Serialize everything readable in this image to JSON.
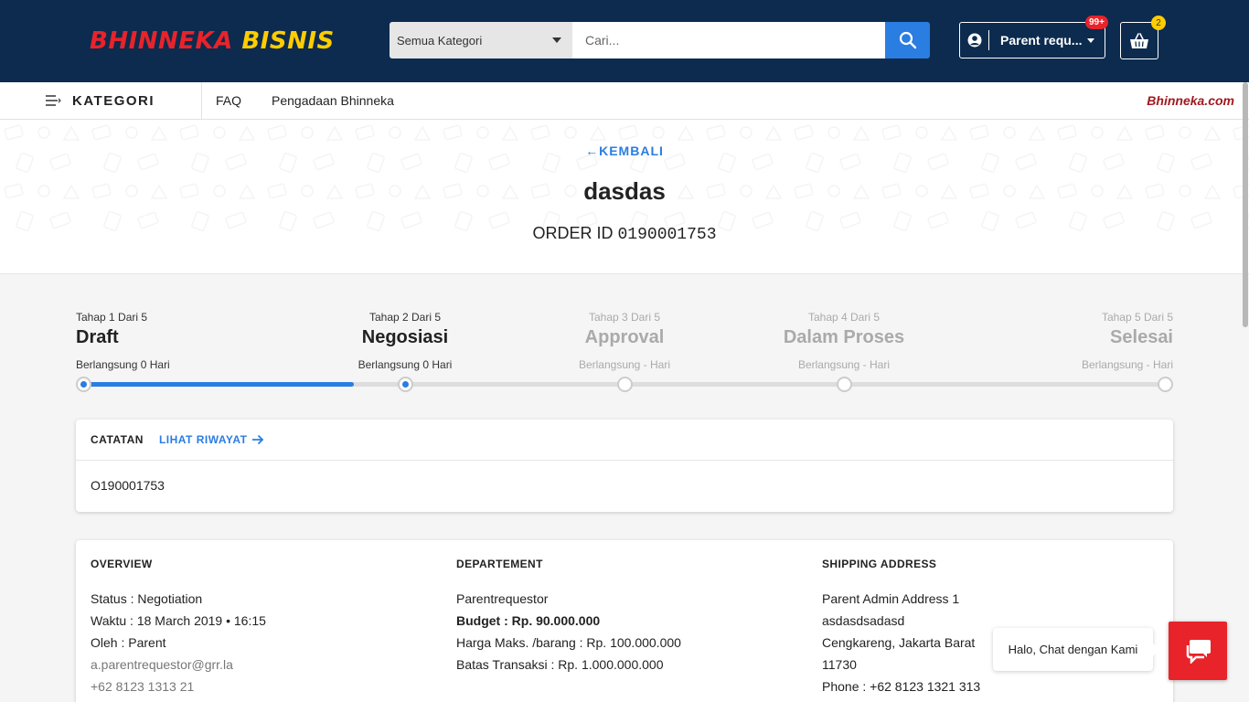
{
  "header": {
    "logo_part1": "BHINNEKA",
    "logo_part2": "BISNIS",
    "category_select": "Semua Kategori",
    "search_placeholder": "Cari...",
    "user_label": "Parent requ...",
    "notification_badge": "99+",
    "cart_count": "2"
  },
  "nav": {
    "kategori": "KATEGORI",
    "links": [
      "FAQ",
      "Pengadaan Bhinneka"
    ],
    "site_link": "Bhinneka.com"
  },
  "hero": {
    "back_label": "KEMBALI",
    "title": "dasdas",
    "order_id_label": "ORDER ID",
    "order_id": "0190001753"
  },
  "steps": [
    {
      "small": "Tahap 1 Dari 5",
      "name": "Draft",
      "duration": "Berlangsung 0 Hari",
      "state": "done"
    },
    {
      "small": "Tahap 2 Dari 5",
      "name": "Negosiasi",
      "duration": "Berlangsung 0 Hari",
      "state": "current"
    },
    {
      "small": "Tahap 3 Dari 5",
      "name": "Approval",
      "duration": "Berlangsung - Hari",
      "state": "pending"
    },
    {
      "small": "Tahap 4 Dari 5",
      "name": "Dalam Proses",
      "duration": "Berlangsung - Hari",
      "state": "pending"
    },
    {
      "small": "Tahap 5 Dari 5",
      "name": "Selesai",
      "duration": "Berlangsung - Hari",
      "state": "pending"
    }
  ],
  "progress_fraction": 0.25,
  "catatan": {
    "title": "CATATAN",
    "history_link": "LIHAT RIWAYAT",
    "note": "O190001753"
  },
  "overview": {
    "title": "OVERVIEW",
    "status": "Status : Negotiation",
    "waktu": "Waktu : 18 March 2019 • 16:15",
    "oleh": "Oleh : Parent",
    "email": "a.parentrequestor@grr.la",
    "phone": "+62 8123 1313 21"
  },
  "department": {
    "title": "DEPARTEMENT",
    "name": "Parentrequestor",
    "budget": "Budget : Rp. 90.000.000",
    "harga": "Harga Maks. /barang : Rp. 100.000.000",
    "batas": "Batas Transaksi : Rp. 1.000.000.000"
  },
  "shipping": {
    "title": "SHIPPING ADDRESS",
    "line1": "Parent Admin Address 1",
    "line2": "asdasdsadasd",
    "line3": "Cengkareng, Jakarta Barat",
    "line4": "11730",
    "phone": "Phone : +62 8123 1321 313"
  },
  "chat": {
    "label": "Halo, Chat dengan Kami"
  },
  "colors": {
    "header_bg": "#0c2b4e",
    "accent_blue": "#2a7de1",
    "brand_red": "#e8232a",
    "brand_yellow": "#ffcc00"
  }
}
